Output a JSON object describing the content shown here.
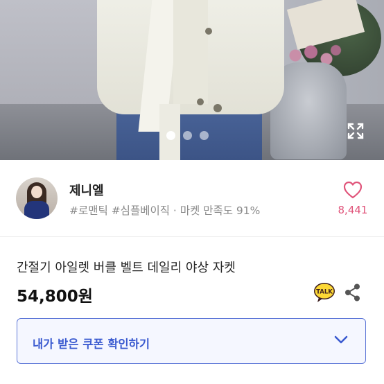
{
  "gallery": {
    "page_count": 3,
    "active_index": 0
  },
  "seller": {
    "name": "제니엘",
    "tags": "#로맨틱 #심플베이직 · 마켓 만족도 91%",
    "likes": "8,441"
  },
  "product": {
    "title": "간절기 아일렛 버클 벨트 데일리 야상 자켓",
    "price": "54,800원"
  },
  "coupon": {
    "label": "내가 받은 쿠폰 확인하기"
  },
  "icons": {
    "expand": "expand-icon",
    "like": "heart-icon",
    "talk": "kakao-talk-icon",
    "share": "share-icon",
    "chevron": "chevron-down-icon"
  },
  "colors": {
    "accent_blue": "#3b5bd0",
    "like_pink": "#e0547a",
    "talk_yellow": "#3c1e1e"
  }
}
